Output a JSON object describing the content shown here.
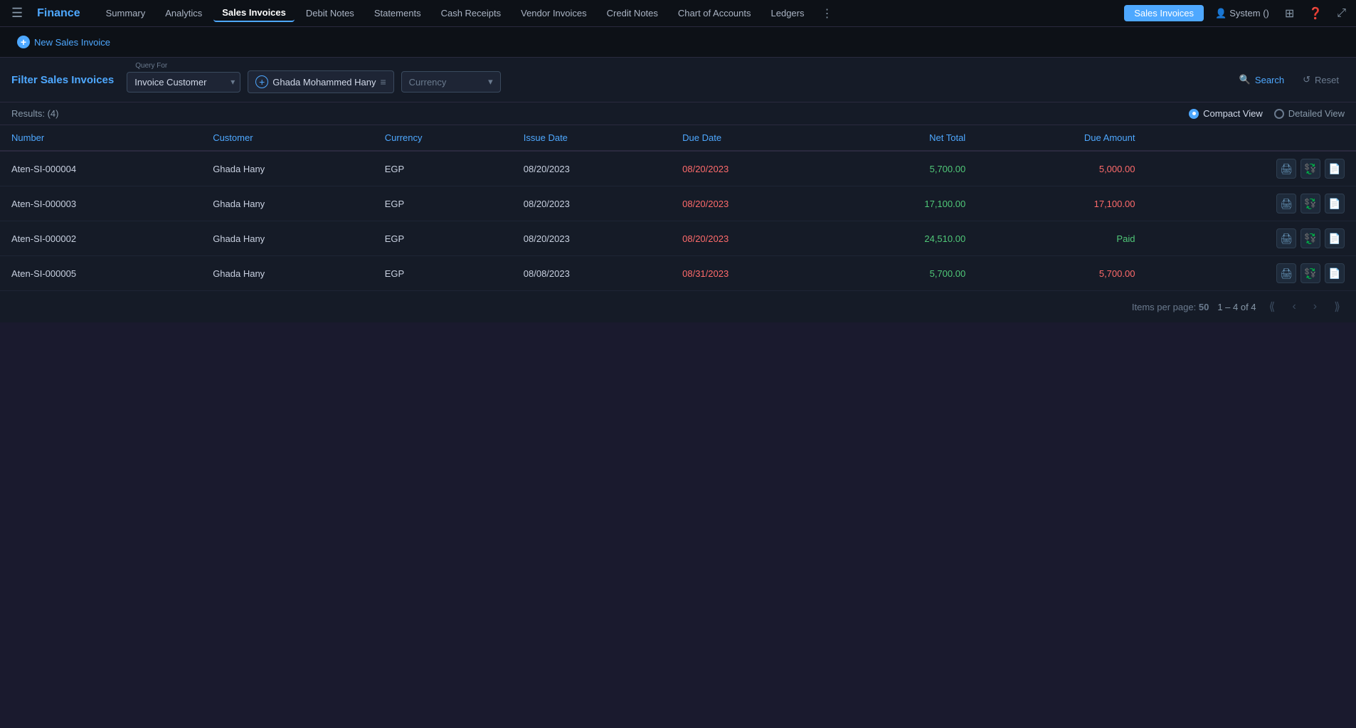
{
  "brand": "Finance",
  "nav": {
    "items": [
      {
        "label": "Summary",
        "active": false
      },
      {
        "label": "Analytics",
        "active": false
      },
      {
        "label": "Sales Invoices",
        "active": true
      },
      {
        "label": "Debit Notes",
        "active": false
      },
      {
        "label": "Statements",
        "active": false
      },
      {
        "label": "Cash Receipts",
        "active": false
      },
      {
        "label": "Vendor Invoices",
        "active": false
      },
      {
        "label": "Credit Notes",
        "active": false
      },
      {
        "label": "Chart of Accounts",
        "active": false
      },
      {
        "label": "Ledgers",
        "active": false
      }
    ],
    "active_badge": "Sales Invoices",
    "user": "System ()",
    "more_icon": "⋮"
  },
  "sub_bar": {
    "new_invoice_label": "New Sales Invoice"
  },
  "filter": {
    "title": "Filter Sales Invoices",
    "query_for_label": "Query For",
    "invoice_customer_label": "Invoice Customer",
    "customer_name": "Ghada Mohammed Hany",
    "currency_label": "Currency",
    "search_label": "Search",
    "reset_label": "Reset"
  },
  "results": {
    "count_label": "Results: (4)",
    "compact_view_label": "Compact View",
    "detailed_view_label": "Detailed View"
  },
  "table": {
    "columns": [
      {
        "key": "number",
        "label": "Number"
      },
      {
        "key": "customer",
        "label": "Customer"
      },
      {
        "key": "currency",
        "label": "Currency"
      },
      {
        "key": "issue_date",
        "label": "Issue Date"
      },
      {
        "key": "due_date",
        "label": "Due Date"
      },
      {
        "key": "net_total",
        "label": "Net Total"
      },
      {
        "key": "due_amount",
        "label": "Due Amount"
      }
    ],
    "rows": [
      {
        "number": "Aten-SI-000004",
        "customer": "Ghada Hany",
        "currency": "EGP",
        "issue_date": "08/20/2023",
        "due_date": "08/20/2023",
        "due_date_overdue": true,
        "net_total": "5,700.00",
        "due_amount": "5,000.00",
        "due_paid": false
      },
      {
        "number": "Aten-SI-000003",
        "customer": "Ghada Hany",
        "currency": "EGP",
        "issue_date": "08/20/2023",
        "due_date": "08/20/2023",
        "due_date_overdue": true,
        "net_total": "17,100.00",
        "due_amount": "17,100.00",
        "due_paid": false
      },
      {
        "number": "Aten-SI-000002",
        "customer": "Ghada Hany",
        "currency": "EGP",
        "issue_date": "08/20/2023",
        "due_date": "08/20/2023",
        "due_date_overdue": true,
        "net_total": "24,510.00",
        "due_amount": "Paid",
        "due_paid": true
      },
      {
        "number": "Aten-SI-000005",
        "customer": "Ghada Hany",
        "currency": "EGP",
        "issue_date": "08/08/2023",
        "due_date": "08/31/2023",
        "due_date_overdue": true,
        "net_total": "5,700.00",
        "due_amount": "5,700.00",
        "due_paid": false
      }
    ]
  },
  "pagination": {
    "items_per_page_label": "Items per page:",
    "items_per_page": "50",
    "range": "1 – 4 of 4"
  },
  "colors": {
    "brand": "#4ea8ff",
    "overdue": "#ff6b6b",
    "paid": "#50c878",
    "muted": "#6a7a8e"
  }
}
